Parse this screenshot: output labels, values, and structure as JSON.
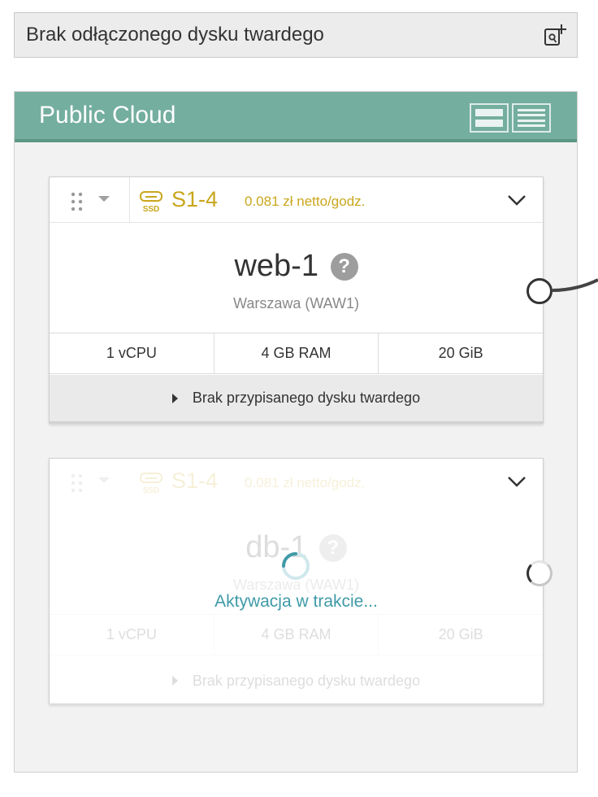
{
  "detached_disk": {
    "label": "Brak odłączonego dysku twardego",
    "icon": "add-disk-icon"
  },
  "cloud": {
    "title": "Public Cloud",
    "header_color": "#74ae9e",
    "view_modes": [
      "large-view",
      "compact-view"
    ]
  },
  "servers": [
    {
      "plan": "S1-4",
      "price": "0.081 zł netto/godz.",
      "name": "web-1",
      "help": "?",
      "location": "Warszawa (WAW1)",
      "specs": [
        "1 vCPU",
        "4 GB RAM",
        "20 GiB"
      ],
      "disk": "Brak przypisanego dysku twardego",
      "status": "active"
    },
    {
      "plan": "S1-4",
      "price": "0.081 zł netto/godz.",
      "name": "db-1",
      "help": "?",
      "location": "Warszawa (WAW1)",
      "specs": [
        "1 vCPU",
        "4 GB RAM",
        "20 GiB"
      ],
      "disk": "Brak przypisanego dysku twardego",
      "status_text": "Aktywacja w trakcie..."
    }
  ],
  "colors": {
    "plan_accent": "#c9a61c",
    "activation_text": "#3f9aa7"
  }
}
